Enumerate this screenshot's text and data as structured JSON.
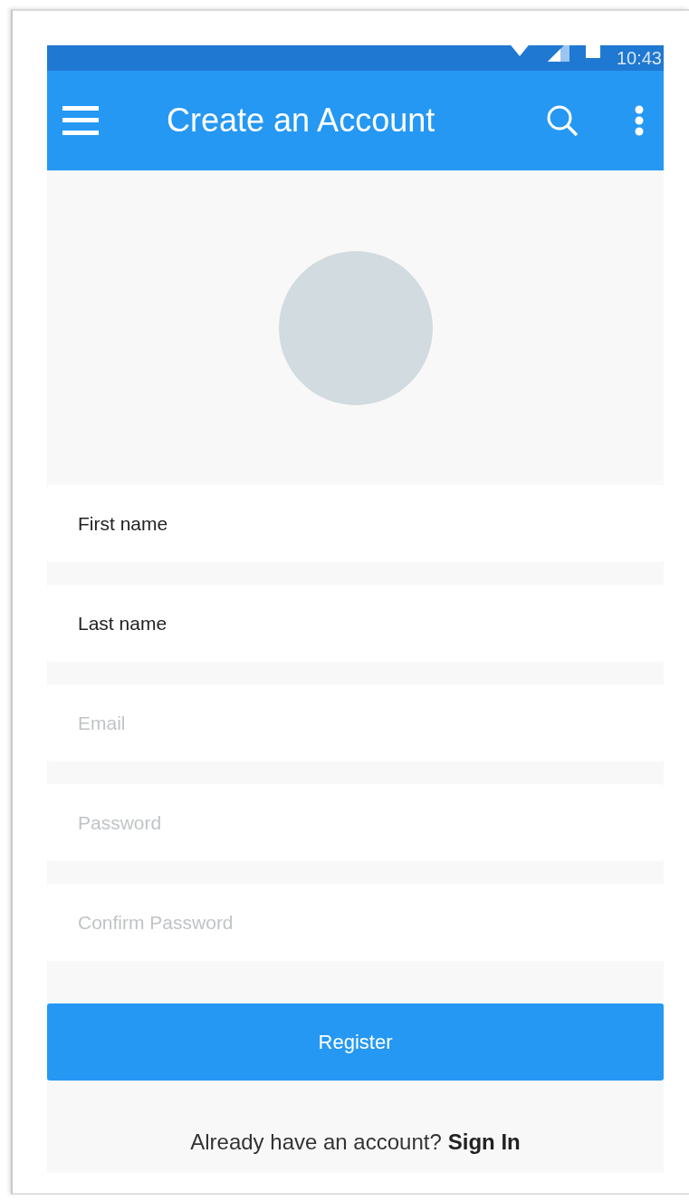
{
  "status_bar": {
    "time": "10:43"
  },
  "app_bar": {
    "title": "Create an Account"
  },
  "fields": [
    {
      "value": "First name"
    },
    {
      "value": "Last name"
    },
    {
      "placeholder": "Email"
    },
    {
      "placeholder": "Password"
    },
    {
      "placeholder": "Confirm Password"
    }
  ],
  "register_button": "Register",
  "footer": {
    "text": "Already have an account?",
    "link": "Sign In"
  }
}
